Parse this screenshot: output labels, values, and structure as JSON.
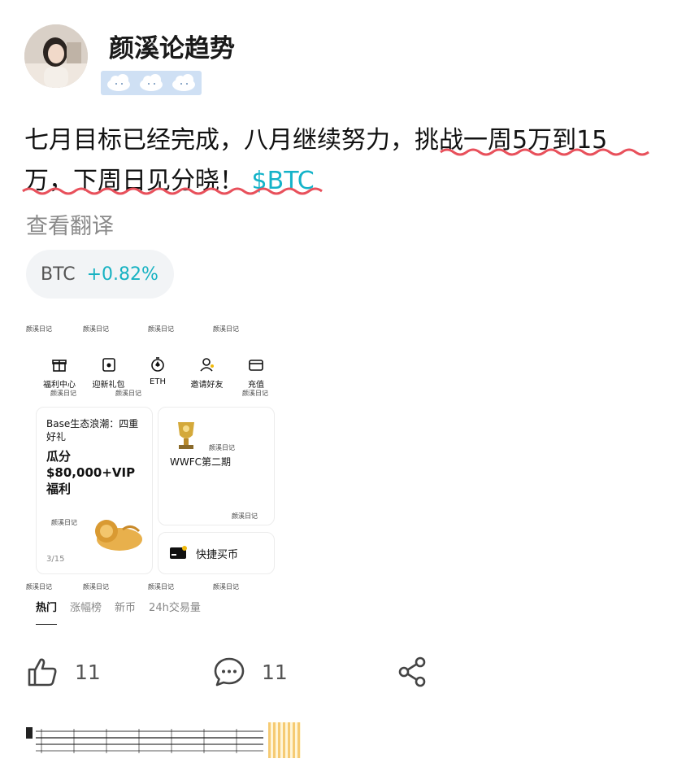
{
  "post": {
    "author": "颜溪论趋势",
    "text_part1": "七月目标已经完成，八月继续努力，挑战一周5万到15",
    "text_part2": "万，下周日见分晓！",
    "ticker": "$BTC",
    "translate_link": "查看翻译"
  },
  "chip": {
    "symbol": "BTC",
    "change": "+0.82%"
  },
  "embed": {
    "watermark": "颜溪日记",
    "quick_actions": [
      {
        "label": "福利中心",
        "icon": "gift-icon"
      },
      {
        "label": "迎新礼包",
        "icon": "giftbox-icon"
      },
      {
        "label": "ETH",
        "icon": "eth-icon"
      },
      {
        "label": "邀请好友",
        "icon": "invite-icon"
      },
      {
        "label": "充值",
        "icon": "wallet-icon"
      }
    ],
    "promo_card": {
      "title": "Base生态浪潮：四重好礼",
      "highlight": "瓜分$80,000+VIP福利",
      "page": "3/15"
    },
    "event_card": {
      "title": "WWFC第二期"
    },
    "quick_buy": {
      "label": "快捷买币"
    },
    "tabs": [
      "热门",
      "涨幅榜",
      "新币",
      "24h交易量"
    ]
  },
  "actions": {
    "likes": "11",
    "comments": "11"
  },
  "colors": {
    "ticker": "#14b3c9",
    "squiggle": "#e8505b",
    "badge_bg": "#cfe0f4"
  }
}
